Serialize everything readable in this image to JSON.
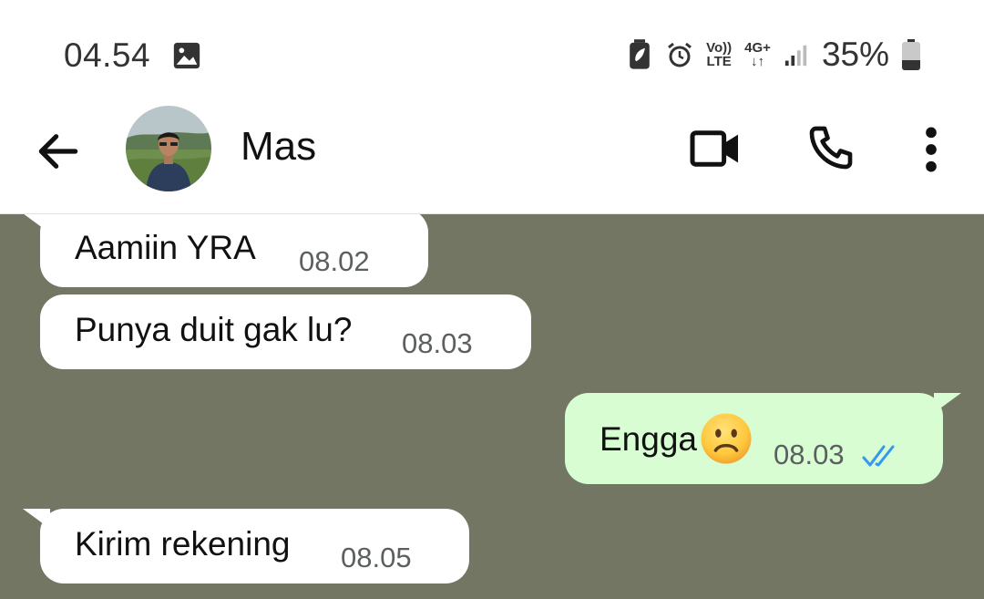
{
  "status_bar": {
    "time": "04.54",
    "volte_top": "Vo))",
    "volte_bottom": "LTE",
    "network_top": "4G+",
    "network_bottom": "↓↑",
    "battery_percent": "35%",
    "battery_level": 0.35
  },
  "header": {
    "contact_name": "Mas"
  },
  "messages": [
    {
      "direction": "incoming",
      "text": "Aamiin YRA",
      "time": "08.02"
    },
    {
      "direction": "incoming",
      "text": "Punya duit gak lu?",
      "time": "08.03"
    },
    {
      "direction": "outgoing",
      "text": "Engga",
      "emoji": "slightly-frowning-face",
      "time": "08.03",
      "status": "read"
    },
    {
      "direction": "incoming",
      "text": "Kirim rekening",
      "time": "08.05"
    }
  ],
  "colors": {
    "chat_background": "#727663",
    "incoming_bubble": "#ffffff",
    "outgoing_bubble": "#d9fdd3",
    "read_ticks": "#3497f0"
  }
}
